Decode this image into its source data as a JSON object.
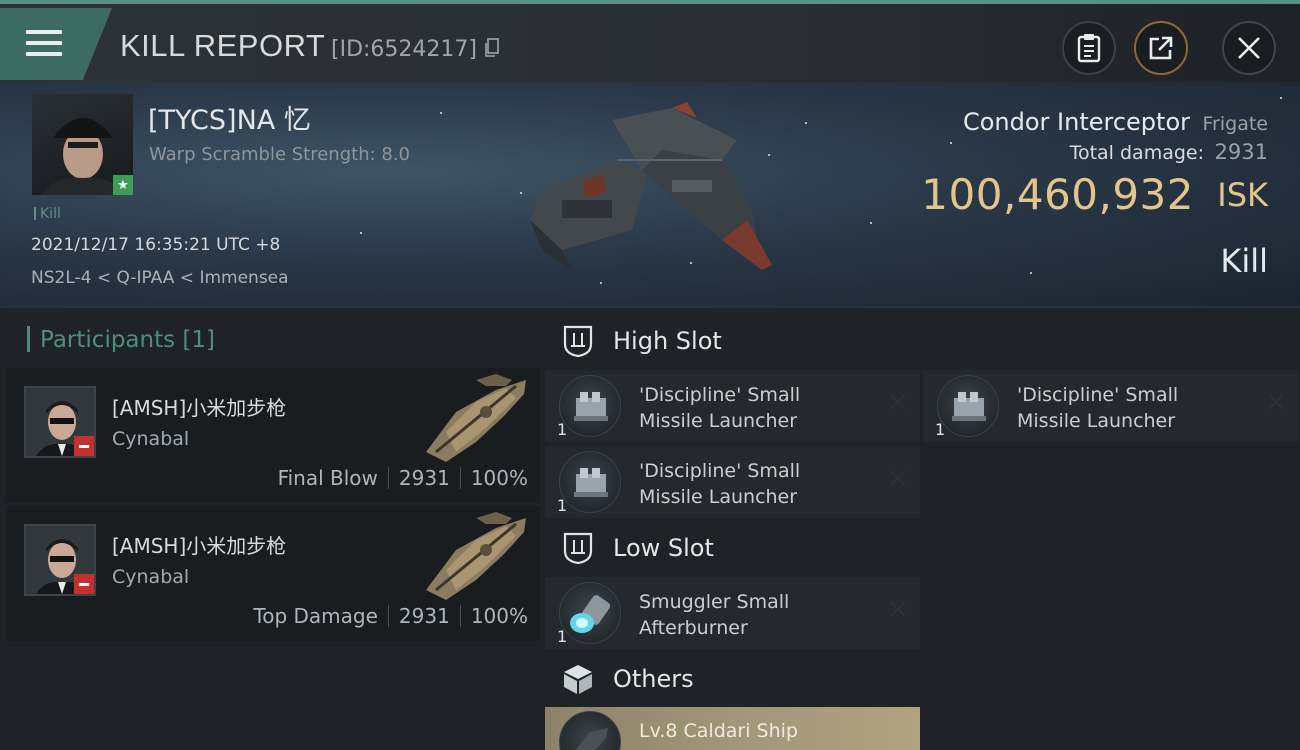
{
  "header": {
    "title": "KILL REPORT",
    "report_id": "[ID:6524217]"
  },
  "victim": {
    "name": "[TYCS]NA 忆",
    "warp_scramble": "Warp Scramble Strength: 8.0",
    "kill_tag": "Kill",
    "datetime": "2021/12/17 16:35:21 UTC +8",
    "location": "NS2L-4 < Q-IPAA < Immensea",
    "ship_name": "Condor Interceptor",
    "ship_class": "Frigate",
    "total_damage_label": "Total damage:",
    "total_damage_value": "2931",
    "isk_value": "100,460,932",
    "isk_unit": "ISK",
    "report_type": "Kill"
  },
  "participants": {
    "title": "Participants [1]",
    "items": [
      {
        "name": "[AMSH]小米加步枪",
        "ship": "Cynabal",
        "role": "Final Blow",
        "damage": "2931",
        "percent": "100%"
      },
      {
        "name": "[AMSH]小米加步枪",
        "ship": "Cynabal",
        "role": "Top Damage",
        "damage": "2931",
        "percent": "100%"
      }
    ]
  },
  "slots": {
    "high": {
      "label": "High Slot",
      "items": [
        {
          "name": "'Discipline' Small Missile Launcher",
          "qty": "1"
        },
        {
          "name": "'Discipline' Small Missile Launcher",
          "qty": "1"
        },
        {
          "name": "'Discipline' Small Missile Launcher",
          "qty": "1"
        }
      ]
    },
    "low": {
      "label": "Low Slot",
      "items": [
        {
          "name": "Smuggler Small Afterburner",
          "qty": "1"
        }
      ]
    },
    "others": {
      "label": "Others",
      "items": [
        {
          "name": "Lv.8 Caldari Ship"
        }
      ]
    }
  },
  "icons": {
    "menu": "menu-icon",
    "copy": "copy-icon",
    "clipboard": "clipboard-icon",
    "share": "share-icon",
    "close": "close-icon",
    "slot": "shield-slot-icon",
    "others": "cube-icon",
    "remove": "x-icon"
  },
  "colors": {
    "accent_teal": "#4e8d80",
    "isk_gold": "#e3c58a",
    "badge_red": "#c4302b"
  }
}
